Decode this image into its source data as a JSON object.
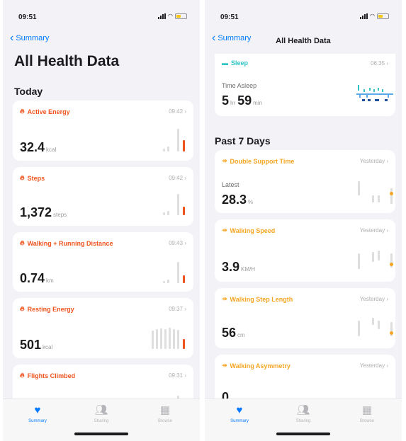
{
  "left": {
    "status": {
      "time": "09:51"
    },
    "nav": {
      "back_label": "Summary"
    },
    "title": "All Health Data",
    "section": "Today",
    "cards": [
      {
        "label": "Active Energy",
        "time": "09:42",
        "value": "32.4",
        "unit": "kcal"
      },
      {
        "label": "Steps",
        "time": "09:42",
        "value": "1,372",
        "unit": "steps"
      },
      {
        "label": "Walking + Running Distance",
        "time": "09:43",
        "value": "0.74",
        "unit": "km"
      },
      {
        "label": "Resting Energy",
        "time": "09:37",
        "value": "501",
        "unit": "kcal"
      },
      {
        "label": "Flights Climbed",
        "time": "09:31"
      }
    ]
  },
  "right": {
    "status": {
      "time": "09:51"
    },
    "nav": {
      "back_label": "Summary",
      "title": "All Health Data"
    },
    "sleep": {
      "label": "Sleep",
      "time": "06:35",
      "sub": "Time Asleep",
      "hours": "5",
      "hours_unit": "hr",
      "minutes": "59",
      "minutes_unit": "min"
    },
    "section": "Past 7 Days",
    "cards": [
      {
        "label": "Double Support Time",
        "time": "Yesterday",
        "sub": "Latest",
        "value": "28.3",
        "unit": "%"
      },
      {
        "label": "Walking Speed",
        "time": "Yesterday",
        "value": "3.9",
        "unit": "KM/H"
      },
      {
        "label": "Walking Step Length",
        "time": "Yesterday",
        "value": "56",
        "unit": "cm"
      },
      {
        "label": "Walking Asymmetry",
        "time": "Yesterday",
        "value": "0",
        "unit": ""
      }
    ]
  },
  "tabs": [
    {
      "label": "Summary",
      "icon": "heart-icon",
      "active": true
    },
    {
      "label": "Sharing",
      "icon": "people-icon",
      "active": false
    },
    {
      "label": "Browse",
      "icon": "grid-icon",
      "active": false
    }
  ],
  "colors": {
    "accent": "#007aff",
    "active_energy": "#f0541e",
    "mobility": "#f5a623",
    "sleep": "#2ec4c6",
    "sleep_dark": "#1f4f9e"
  }
}
